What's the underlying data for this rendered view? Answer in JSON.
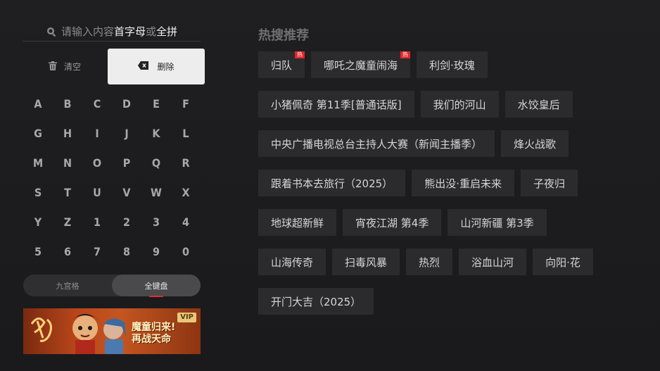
{
  "search": {
    "placeholder_prefix": "请输入内容",
    "hl1": "首字母",
    "mid": "或",
    "hl2": "全拼"
  },
  "actions": {
    "clear_label": "清空",
    "delete_label": "删除"
  },
  "keyboard": {
    "keys": [
      "A",
      "B",
      "C",
      "D",
      "E",
      "F",
      "G",
      "H",
      "I",
      "J",
      "K",
      "L",
      "M",
      "N",
      "O",
      "P",
      "Q",
      "R",
      "S",
      "T",
      "U",
      "V",
      "W",
      "X",
      "Y",
      "Z",
      "1",
      "2",
      "3",
      "4",
      "5",
      "6",
      "7",
      "8",
      "9",
      "0"
    ]
  },
  "mode": {
    "options": [
      "九宫格",
      "全键盘"
    ],
    "selected": "全键盘"
  },
  "banner": {
    "line1": "魔童归来!",
    "line2": "再战天命",
    "badge": "VIP"
  },
  "hot": {
    "title": "热搜推荐",
    "badge_text": "热",
    "rows": [
      [
        {
          "label": "归队",
          "hot": true
        },
        {
          "label": "哪吒之魔童闹海",
          "hot": true
        },
        {
          "label": "利剑·玫瑰",
          "hot": false
        }
      ],
      [
        {
          "label": "小猪佩奇 第11季[普通话版]",
          "hot": false
        },
        {
          "label": "我们的河山",
          "hot": false
        },
        {
          "label": "水饺皇后",
          "hot": false
        }
      ],
      [
        {
          "label": "中央广播电视总台主持人大赛（新闻主播季）",
          "hot": false
        },
        {
          "label": "烽火战歌",
          "hot": false
        }
      ],
      [
        {
          "label": "跟着书本去旅行（2025）",
          "hot": false
        },
        {
          "label": "熊出没·重启未来",
          "hot": false
        },
        {
          "label": "子夜归",
          "hot": false
        }
      ],
      [
        {
          "label": "地球超新鲜",
          "hot": false
        },
        {
          "label": "宵夜江湖 第4季",
          "hot": false
        },
        {
          "label": "山河新疆 第3季",
          "hot": false
        }
      ],
      [
        {
          "label": "山海传奇",
          "hot": false
        },
        {
          "label": "扫毒风暴",
          "hot": false
        },
        {
          "label": "热烈",
          "hot": false
        },
        {
          "label": "浴血山河",
          "hot": false
        },
        {
          "label": "向阳·花",
          "hot": false
        }
      ],
      [
        {
          "label": "开门大吉（2025）",
          "hot": false
        }
      ]
    ]
  }
}
